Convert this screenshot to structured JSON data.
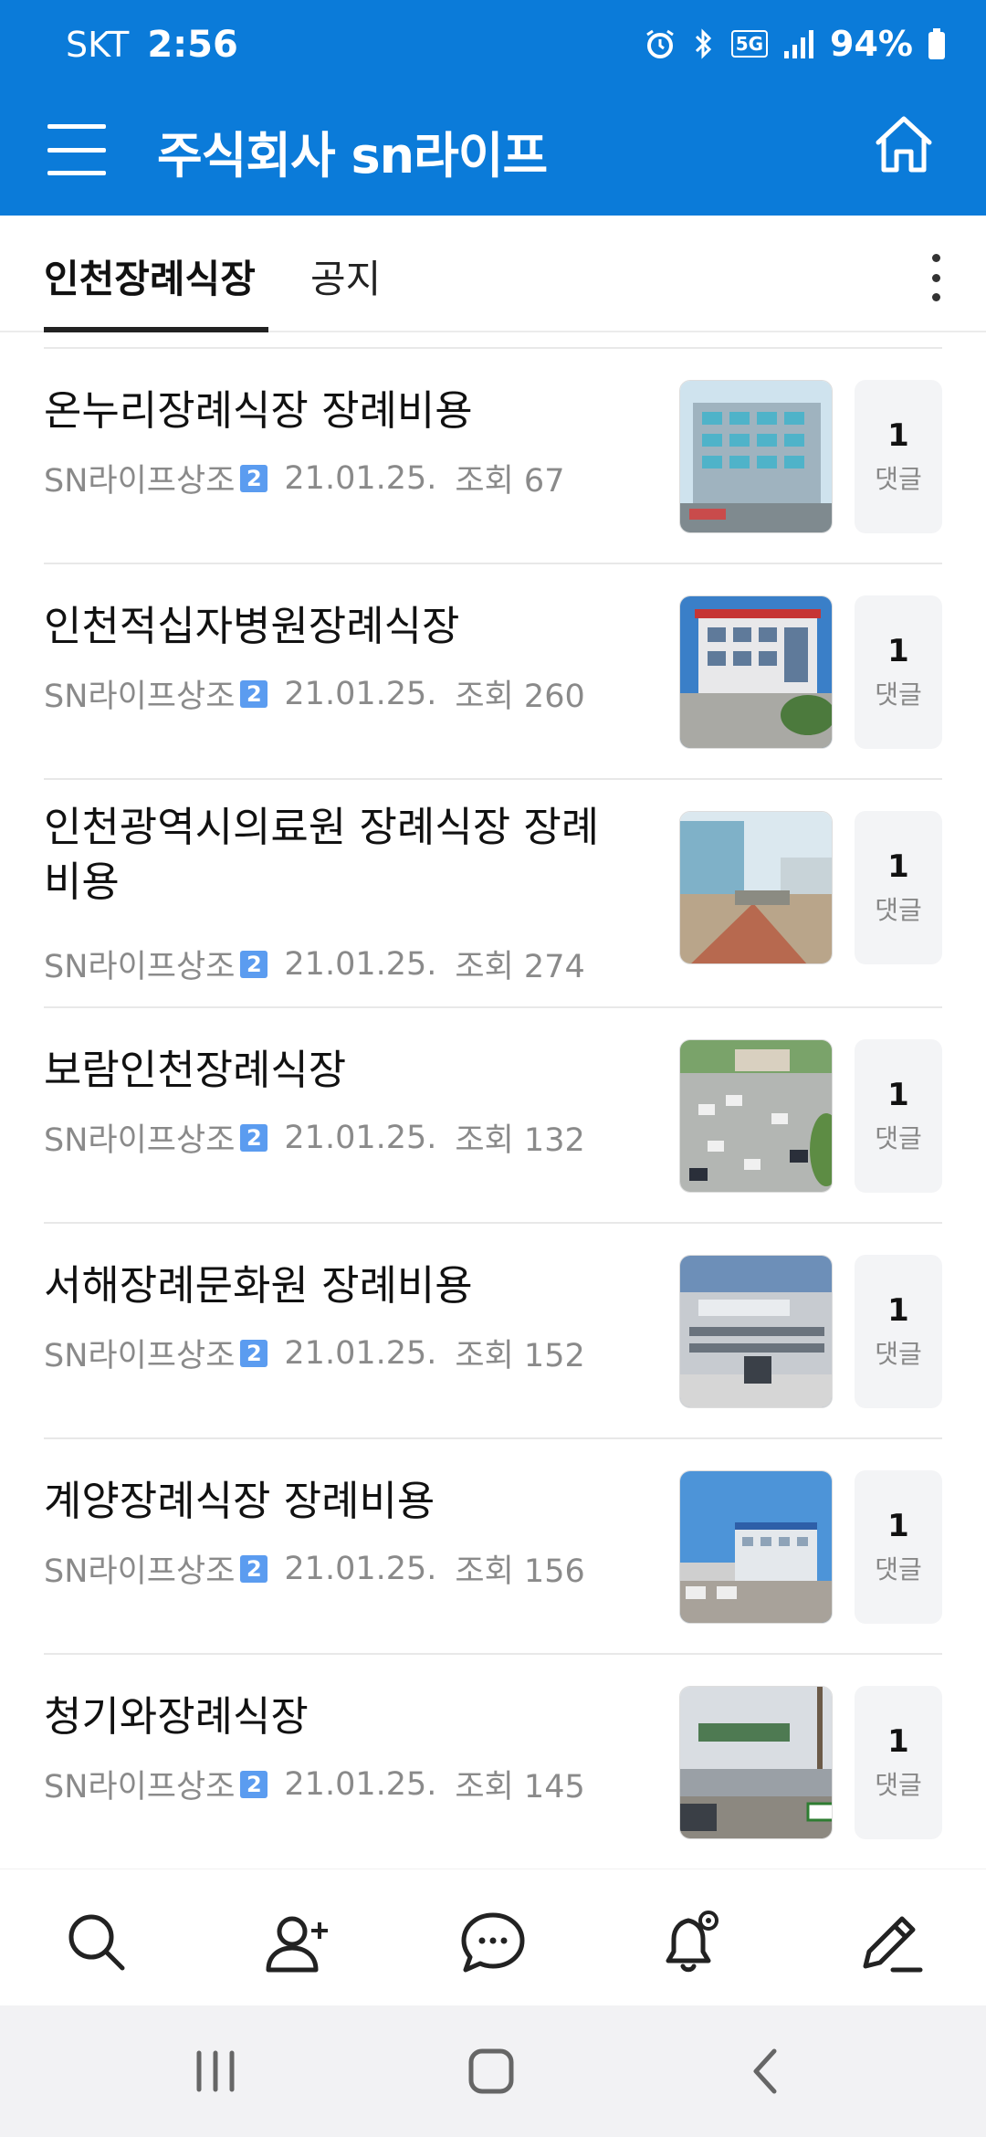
{
  "status_bar": {
    "carrier": "SKT",
    "time": "2:56",
    "network": "5G",
    "battery": "94%"
  },
  "app_bar": {
    "title": "주식회사 sn라이프"
  },
  "tabs": [
    {
      "label": "인천장례식장",
      "active": true
    },
    {
      "label": "공지",
      "active": false
    }
  ],
  "posts": [
    {
      "title": "온누리장례식장 장례비용",
      "author": "SN라이프상조",
      "level": "2",
      "date": "21.01.25.",
      "views": "조회 67",
      "comments": "1",
      "comment_label": "댓글"
    },
    {
      "title": "인천적십자병원장례식장",
      "author": "SN라이프상조",
      "level": "2",
      "date": "21.01.25.",
      "views": "조회 260",
      "comments": "1",
      "comment_label": "댓글"
    },
    {
      "title": "인천광역시의료원 장례식장 장례비용",
      "author": "SN라이프상조",
      "level": "2",
      "date": "21.01.25.",
      "views": "조회 274",
      "comments": "1",
      "comment_label": "댓글"
    },
    {
      "title": "보람인천장례식장",
      "author": "SN라이프상조",
      "level": "2",
      "date": "21.01.25.",
      "views": "조회 132",
      "comments": "1",
      "comment_label": "댓글"
    },
    {
      "title": "서해장례문화원 장례비용",
      "author": "SN라이프상조",
      "level": "2",
      "date": "21.01.25.",
      "views": "조회 152",
      "comments": "1",
      "comment_label": "댓글"
    },
    {
      "title": "계양장례식장 장례비용",
      "author": "SN라이프상조",
      "level": "2",
      "date": "21.01.25.",
      "views": "조회 156",
      "comments": "1",
      "comment_label": "댓글"
    },
    {
      "title": "청기와장례식장",
      "author": "SN라이프상조",
      "level": "2",
      "date": "21.01.25.",
      "views": "조회 145",
      "comments": "1",
      "comment_label": "댓글"
    }
  ],
  "toolbar": {
    "icons": [
      "search-icon",
      "add-member-icon",
      "chat-icon",
      "notification-settings-icon",
      "write-icon"
    ]
  },
  "colors": {
    "brand_blue": "#0b7bd9",
    "level_badge": "#5b9cf0"
  }
}
